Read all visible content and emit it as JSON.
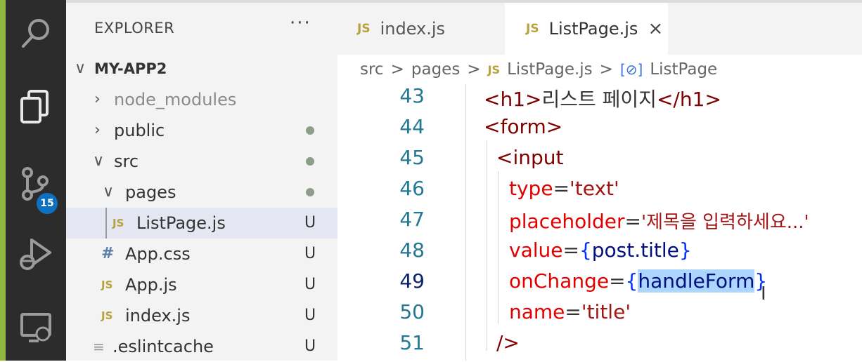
{
  "activity_bar": {
    "scm_badge": "15"
  },
  "sidebar": {
    "title": "EXPLORER",
    "more_label": "···",
    "root_label": "MY-APP2",
    "items": [
      {
        "label": "node_modules",
        "status": ""
      },
      {
        "label": "public",
        "status": "dot"
      },
      {
        "label": "src",
        "status": "dot"
      },
      {
        "label": "pages",
        "status": "dot"
      },
      {
        "label": "ListPage.js",
        "status": "U"
      },
      {
        "label": "App.css",
        "status": "U"
      },
      {
        "label": "App.js",
        "status": "U"
      },
      {
        "label": "index.js",
        "status": "U"
      },
      {
        "label": ".eslintcache",
        "status": "U"
      }
    ]
  },
  "tabs": [
    {
      "label": "index.js",
      "icon": "JS"
    },
    {
      "label": "ListPage.js",
      "icon": "JS",
      "close": "×"
    }
  ],
  "breadcrumb": {
    "parts": [
      "src",
      "pages",
      "ListPage.js",
      "ListPage"
    ],
    "separator": ">",
    "file_icon": "JS",
    "symbol_icon": "[⊘]"
  },
  "editor": {
    "line_numbers": [
      "43",
      "44",
      "45",
      "46",
      "47",
      "48",
      "49",
      "50",
      "51"
    ],
    "line43": {
      "open": "<h1>",
      "text": "리스트 페이지",
      "close": "</h1>"
    },
    "line44": "<form>",
    "line45": "<input",
    "line46": {
      "attr": "type",
      "eq": "=",
      "val": "'text'"
    },
    "line47": {
      "attr": "placeholder",
      "eq": "=",
      "val": "'제목을 입력하세요...'"
    },
    "line48": {
      "attr": "value",
      "eq": "=",
      "lb": "{",
      "val": "post.title",
      "rb": "}"
    },
    "line49": {
      "attr": "onChange",
      "eq": "=",
      "lb": "{",
      "val": "handleForm",
      "rb": "}"
    },
    "line50": {
      "attr": "name",
      "eq": "=",
      "val": "'title'"
    },
    "line51": "/>"
  },
  "colors": {
    "activity_bg": "#2c2c2c",
    "sidebar_bg": "#f3f3f3",
    "badge": "#0e70c0",
    "tag": "#800000",
    "attribute": "#e50000",
    "brace": "#0431fa",
    "selection": "#add6ff"
  }
}
